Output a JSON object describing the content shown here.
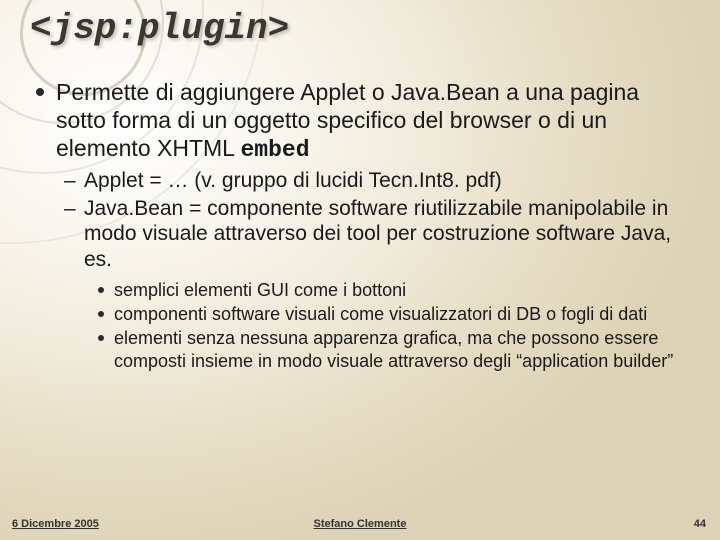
{
  "title": "<jsp:plugin>",
  "bullet1_pre": "Permette di aggiungere Applet o Java.Bean a una pagina sotto forma di un oggetto specifico del browser o di un elemento XHTML ",
  "bullet1_code": "embed",
  "sub": {
    "a": "Applet = … (v. gruppo di lucidi Tecn.Int8. pdf)",
    "b": "Java.Bean = componente software riutilizzabile manipolabile in modo visuale attraverso dei tool per costruzione software Java, es."
  },
  "subsub": {
    "a": "semplici elementi GUI come i bottoni",
    "b": "componenti software visuali come visualizzatori di DB o fogli di dati",
    "c": "elementi senza nessuna apparenza grafica, ma che possono essere composti insieme in modo visuale attraverso degli “application builder”"
  },
  "footer": {
    "left": "6 Dicembre 2005",
    "center": "Stefano Clemente",
    "right": "44"
  }
}
